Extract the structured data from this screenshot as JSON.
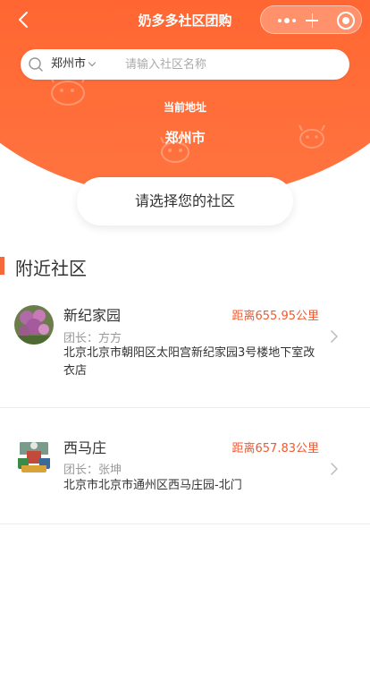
{
  "nav": {
    "title": "奶多多社区团购",
    "back_icon": "chevron-left-icon",
    "capsule_more_icon": "more-dots-icon",
    "capsule_min_icon": "minimize-icon",
    "capsule_close_icon": "close-circle-icon"
  },
  "search": {
    "city": "郑州市",
    "placeholder": "请输入社区名称",
    "icon": "search-icon"
  },
  "location": {
    "label": "当前地址",
    "city": "郑州市"
  },
  "select_button": {
    "label": "请选择您的社区"
  },
  "section": {
    "title": "附近社区"
  },
  "communities": [
    {
      "name": "新纪家园",
      "distance": "距离655.95公里",
      "leader": "团长：方方",
      "address": "北京北京市朝阳区太阳宫新纪家园3号楼地下室改衣店"
    },
    {
      "name": "西马庄",
      "distance": "距离657.83公里",
      "leader": "团长：张坤",
      "address": "北京市北京市通州区西马庄园-北门"
    }
  ],
  "colors": {
    "brand_orange": "#ff5a2b",
    "accent_text": "#ee5a32",
    "section_bar": "#f4683b"
  }
}
